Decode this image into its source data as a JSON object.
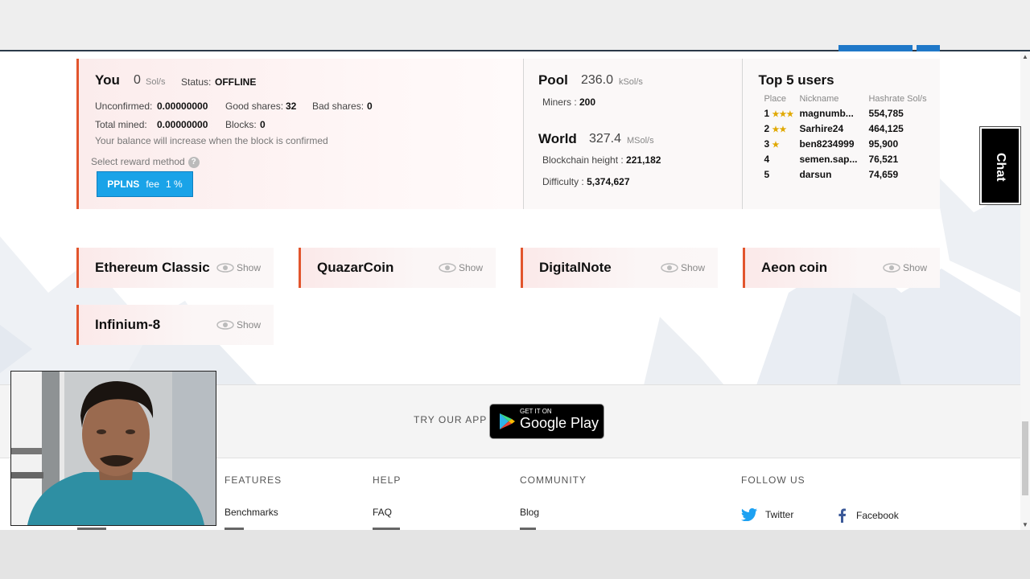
{
  "you": {
    "title": "You",
    "speed": "0",
    "speed_unit": "Sol/s",
    "status_label": "Status:",
    "status_value": "OFFLINE",
    "unconfirmed_label": "Unconfirmed:",
    "unconfirmed_value": "0.00000000",
    "good_shares_label": "Good shares:",
    "good_shares_value": "32",
    "bad_shares_label": "Bad shares:",
    "bad_shares_value": "0",
    "total_mined_label": "Total mined:",
    "total_mined_value": "0.00000000",
    "blocks_label": "Blocks:",
    "blocks_value": "0",
    "note": "Your balance will increase when the block is confirmed",
    "reward_label": "Select reward method",
    "reward_help": "?",
    "reward_button_name": "PPLNS",
    "reward_button_fee": "fee",
    "reward_button_pct": "1 %"
  },
  "pool": {
    "title": "Pool",
    "speed": "236.0",
    "unit": "kSol/s",
    "miners_label": "Miners",
    "miners_value": "200"
  },
  "world": {
    "title": "World",
    "speed": "327.4",
    "unit": "MSol/s",
    "height_label": "Blockchain height",
    "height_value": "221,182",
    "difficulty_label": "Difficulty",
    "difficulty_value": "5,374,627"
  },
  "top_users": {
    "title": "Top 5 users",
    "headers": [
      "Place",
      "Nickname",
      "Hashrate Sol/s"
    ],
    "rows": [
      {
        "place": "1",
        "stars": "★★★",
        "nick": "magnumb...",
        "rate": "554,785"
      },
      {
        "place": "2",
        "stars": "★★",
        "nick": "Sarhire24",
        "rate": "464,125"
      },
      {
        "place": "3",
        "stars": "★",
        "nick": "ben8234999",
        "rate": "95,900"
      },
      {
        "place": "4",
        "stars": "",
        "nick": "semen.sap...",
        "rate": "76,521"
      },
      {
        "place": "5",
        "stars": "",
        "nick": "darsun",
        "rate": "74,659"
      }
    ]
  },
  "coins": {
    "show_label": "Show",
    "items": [
      "Ethereum Classic",
      "QuazarCoin",
      "DigitalNote",
      "Aeon coin",
      "Infinium-8"
    ]
  },
  "app": {
    "try_label": "TRY OUR APP",
    "store_small": "GET IT ON",
    "store_large": "Google Play"
  },
  "footer": {
    "features_heading": "FEATURES",
    "features_link": "Benchmarks",
    "help_heading": "HELP",
    "help_link": "FAQ",
    "community_heading": "COMMUNITY",
    "community_link": "Blog",
    "follow_heading": "FOLLOW US",
    "twitter": "Twitter",
    "facebook": "Facebook"
  },
  "chat": {
    "label": "Chat"
  },
  "colors": {
    "accent": "#e2552d",
    "button": "#1aa3e8",
    "twitter": "#1da1f2",
    "facebook": "#3b5998",
    "star": "#e0a800"
  }
}
